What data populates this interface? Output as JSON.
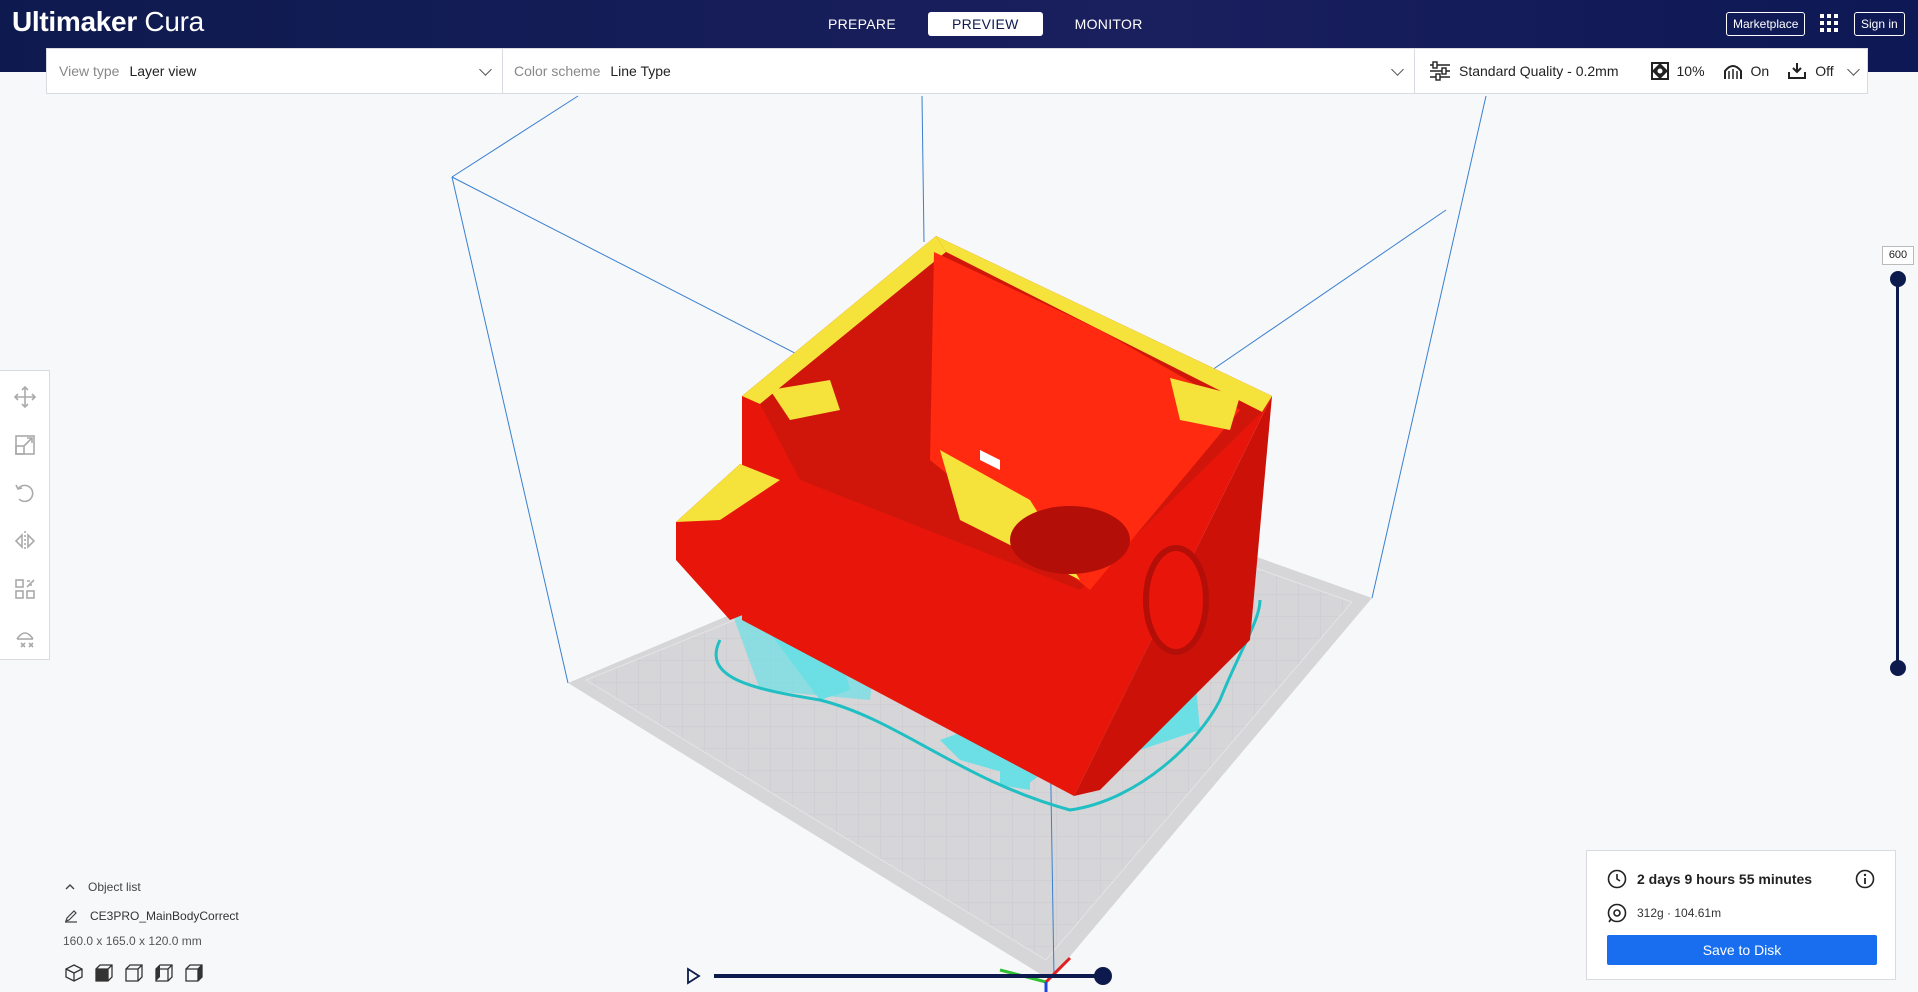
{
  "app": {
    "title_bold": "Ultimaker",
    "title_light": " Cura"
  },
  "stages": [
    {
      "label": "PREPARE",
      "active": false
    },
    {
      "label": "PREVIEW",
      "active": true
    },
    {
      "label": "MONITOR",
      "active": false
    }
  ],
  "header": {
    "marketplace_label": "Marketplace",
    "signin_label": "Sign in",
    "apps_icon": "apps-grid-icon"
  },
  "toolbar": {
    "view_type_label": "View type",
    "view_type_value": "Layer view",
    "color_scheme_label": "Color scheme",
    "color_scheme_value": "Line Type",
    "profile": "Standard Quality - 0.2mm",
    "infill": "10%",
    "support": "On",
    "adhesion": "Off"
  },
  "tools": [
    "move-icon",
    "scale-icon",
    "rotate-icon",
    "mirror-icon",
    "per-model-settings-icon",
    "support-blocker-icon"
  ],
  "layer_slider": {
    "value": "600"
  },
  "object_list": {
    "toggle_label": "Object list",
    "object_name": "CE3PRO_MainBodyCorrect",
    "dimensions": "160.0 x 165.0 x 120.0 mm"
  },
  "print_info": {
    "time": "2 days 9 hours 55 minutes",
    "material": "312g · 104.61m",
    "save_label": "Save to Disk"
  },
  "colors": {
    "header_bg": "#0e1a4f",
    "accent_blue": "#196ef0",
    "model_wall": "#ff1a00",
    "model_skin": "#ffff33",
    "support": "#5fe0e6"
  }
}
